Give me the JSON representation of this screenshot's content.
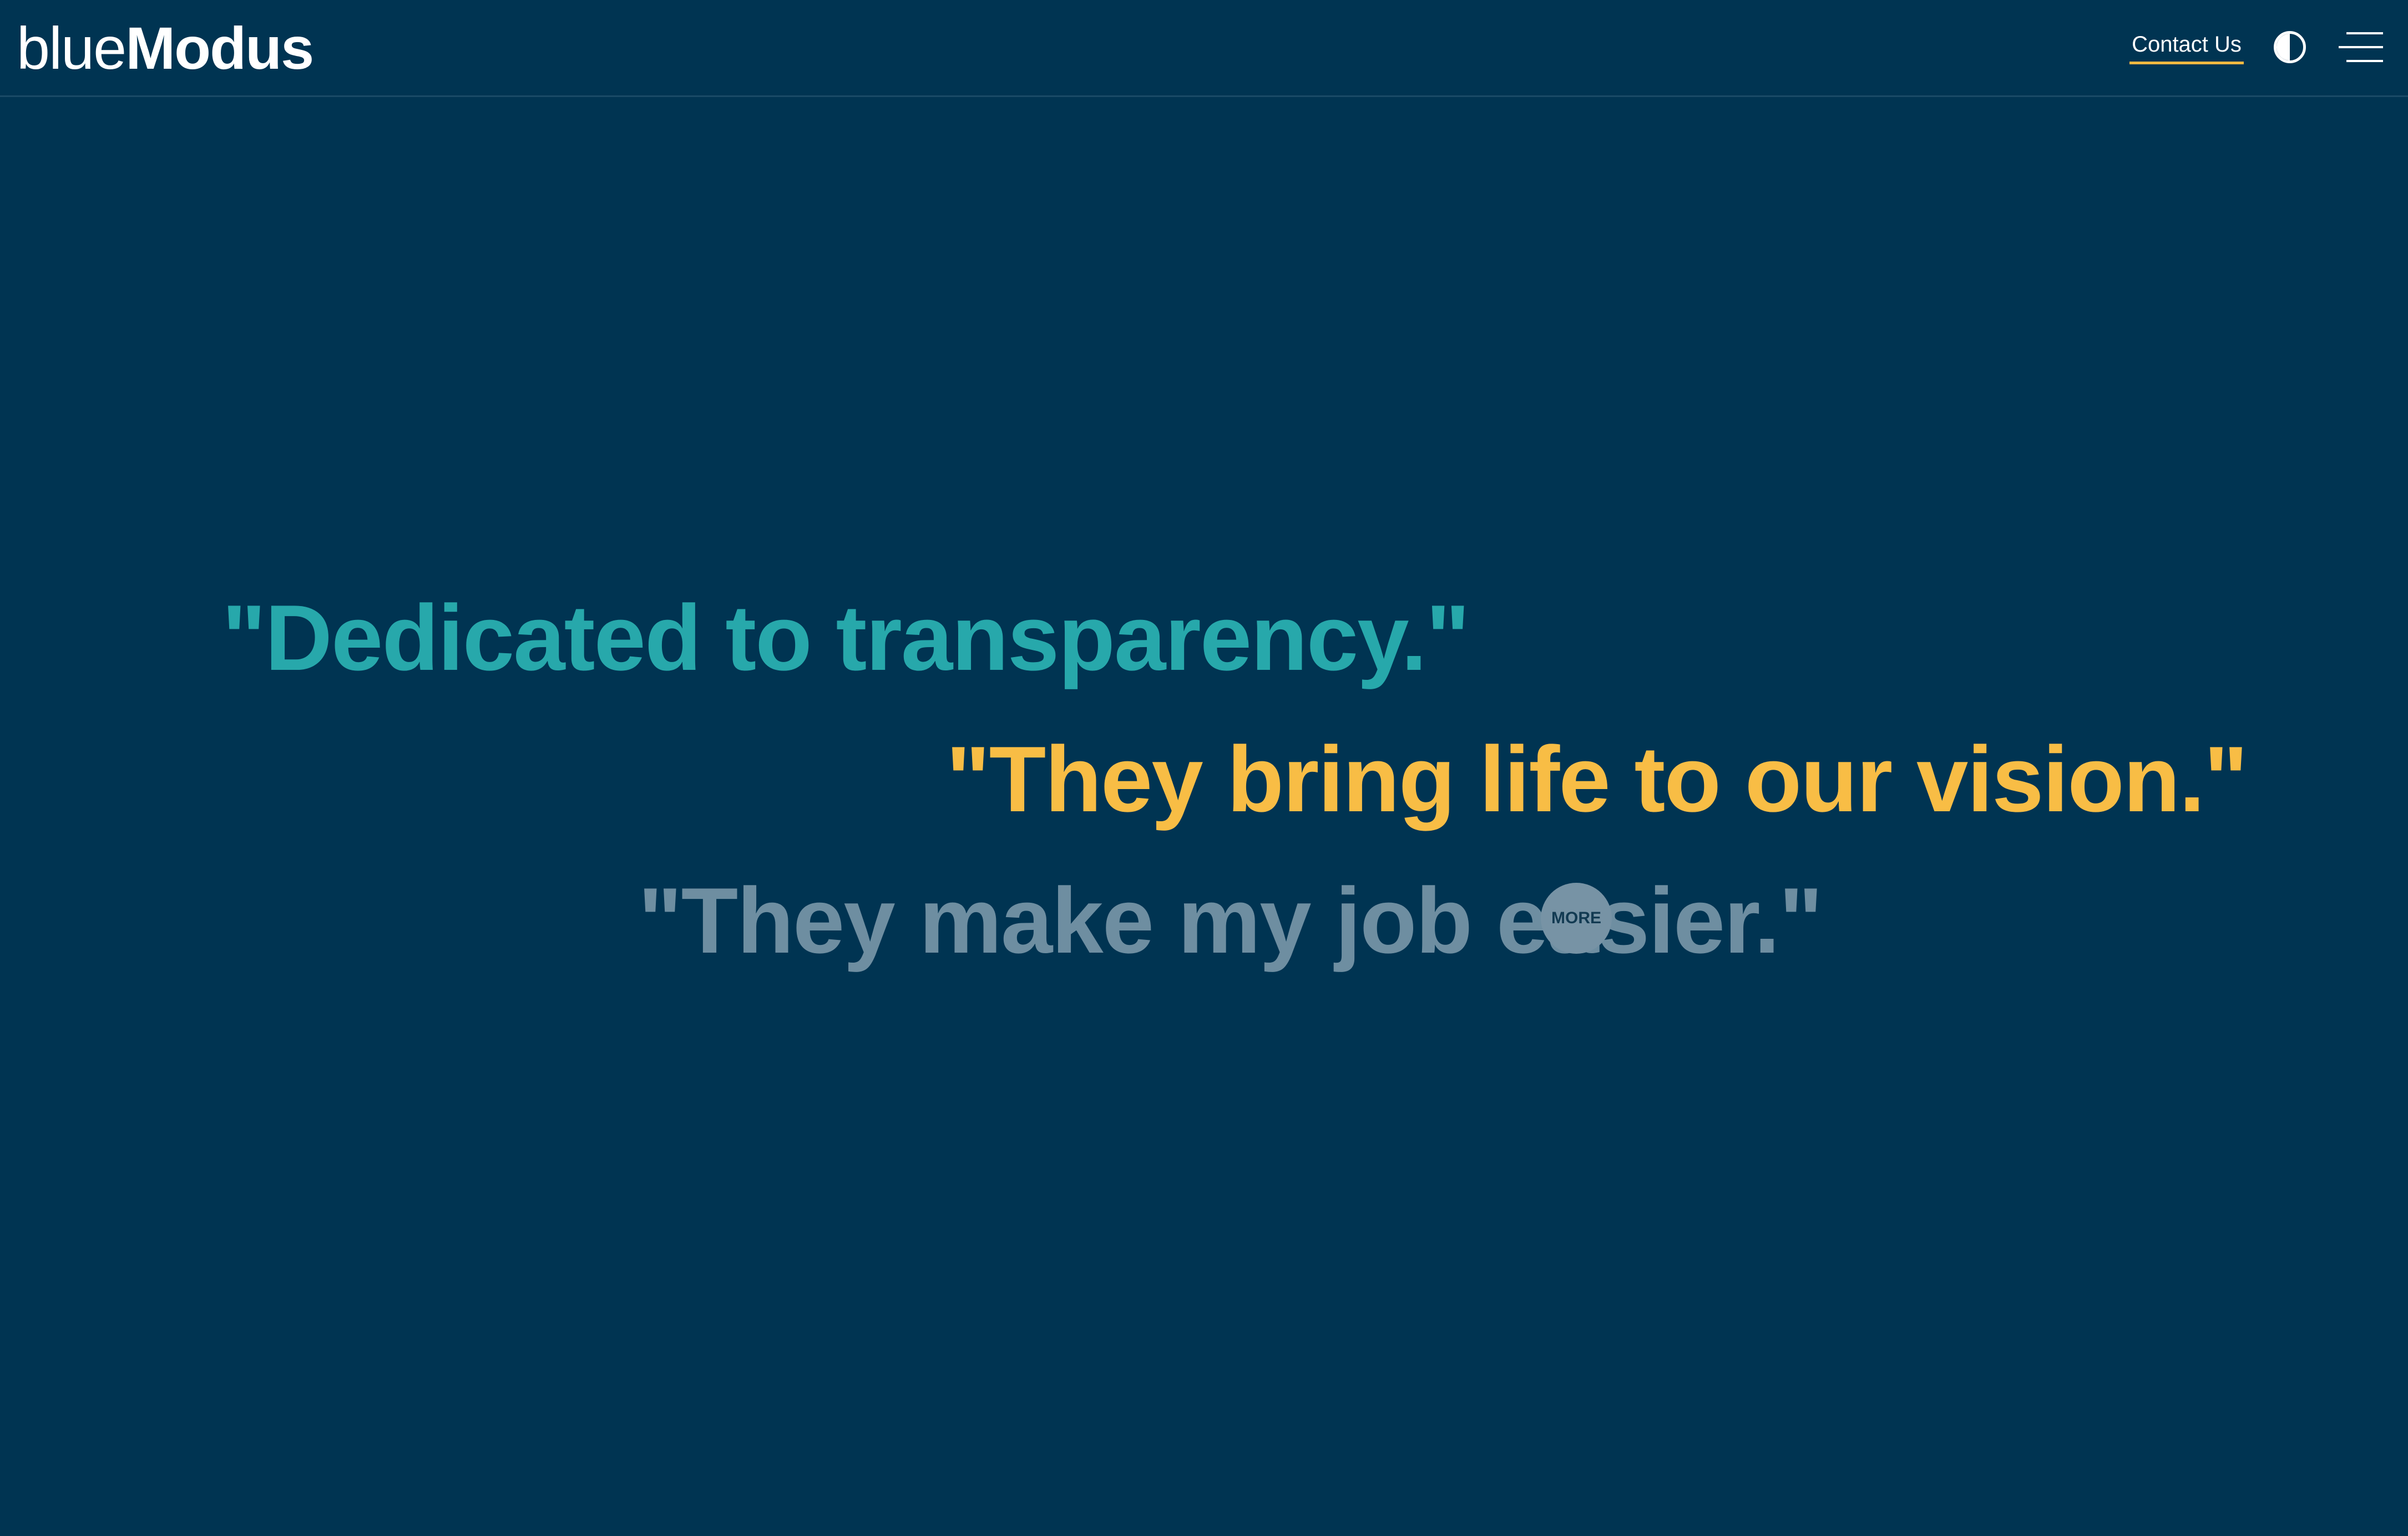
{
  "header": {
    "logo": {
      "light": "blue",
      "bold": "Modus"
    },
    "contact_label": "Contact Us",
    "contrast_icon": "contrast-icon",
    "menu_icon": "hamburger-menu-icon"
  },
  "hero": {
    "quotes": [
      {
        "text": "\"Dedicated to transparency.\"",
        "color": "#27a8ab"
      },
      {
        "text": "\"They bring life to our vision.\"",
        "color": "#f8bd45"
      },
      {
        "text": "\"They make my job easier.\"",
        "color": "#6e8ea1"
      }
    ],
    "more_label": "MORE"
  },
  "colors": {
    "background": "#003452",
    "accent": "#f4b841"
  }
}
